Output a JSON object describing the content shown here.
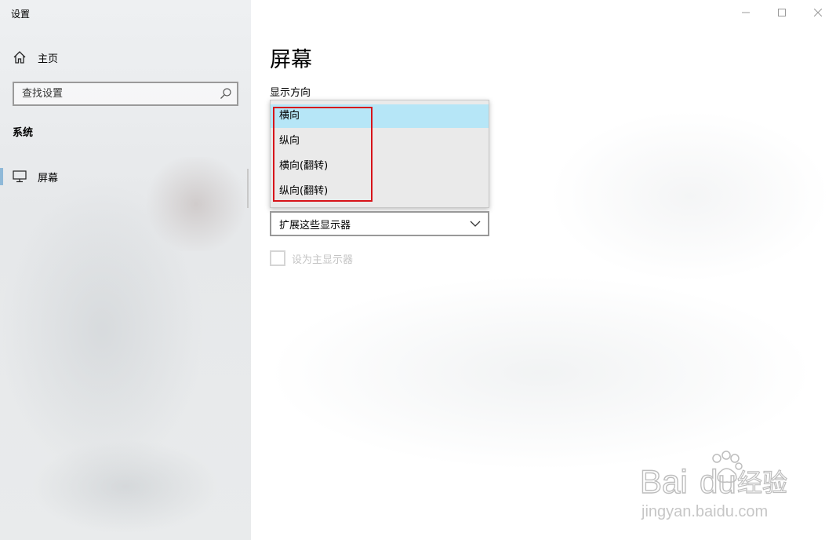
{
  "window": {
    "title": "设置"
  },
  "sidebar": {
    "home_label": "主页",
    "search_placeholder": "查找设置",
    "section": "系统",
    "items": [
      {
        "label": "屏幕",
        "icon": "monitor-icon",
        "active": true
      }
    ]
  },
  "main": {
    "page_title": "屏幕",
    "orientation_label": "显示方向",
    "orientation_options": [
      "横向",
      "纵向",
      "横向(翻转)",
      "纵向(翻转)"
    ],
    "orientation_selected": "横向",
    "multi_display_value": "扩展这些显示器",
    "primary_checkbox_label": "设为主显示器"
  },
  "watermark": {
    "brand": "Baidu",
    "brand_cn": "经验",
    "url": "jingyan.baidu.com"
  },
  "colors": {
    "accent": "#8fb9d8",
    "selected_option": "#b6e6f7",
    "highlight_border": "#d7141a"
  }
}
